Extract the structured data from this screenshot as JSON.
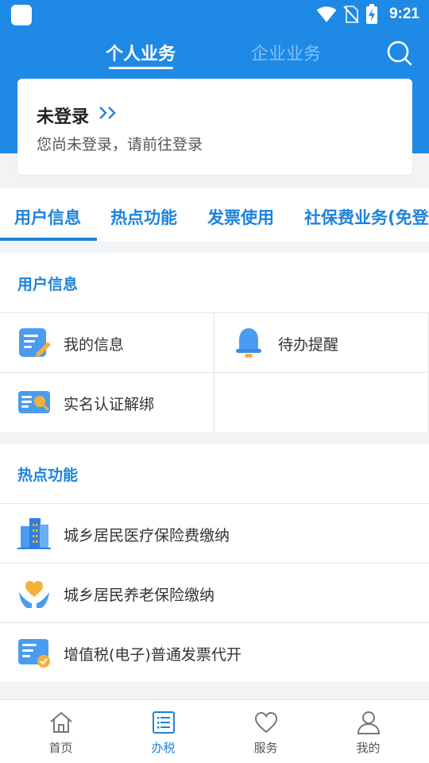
{
  "colors": {
    "primary": "#1e8ae6",
    "accent": "#1d83de",
    "background": "#f2f3f5"
  },
  "status_bar": {
    "time": "9:21",
    "icons": [
      "app-icon",
      "wifi-icon",
      "no-sim-icon",
      "battery-charging-icon"
    ]
  },
  "top_tabs": [
    {
      "label": "个人业务",
      "active": true
    },
    {
      "label": "企业业务",
      "active": false
    }
  ],
  "login": {
    "title": "未登录",
    "subtitle": "您尚未登录，请前往登录"
  },
  "categories": [
    "用户信息",
    "热点功能",
    "发票使用",
    "社保费业务(免登"
  ],
  "user_info": {
    "title": "用户信息",
    "items": [
      {
        "label": "我的信息",
        "icon": "edit-document-icon"
      },
      {
        "label": "待办提醒",
        "icon": "bell-icon"
      },
      {
        "label": "实名认证解绑",
        "icon": "id-card-search-icon"
      }
    ]
  },
  "hot": {
    "title": "热点功能",
    "items": [
      {
        "label": "城乡居民医疗保险费缴纳",
        "icon": "buildings-icon"
      },
      {
        "label": "城乡居民养老保险缴纳",
        "icon": "heart-hands-icon"
      },
      {
        "label": "增值税(电子)普通发票代开",
        "icon": "invoice-icon"
      }
    ]
  },
  "bottom_nav": [
    {
      "label": "首页",
      "icon": "home-icon",
      "active": false
    },
    {
      "label": "办税",
      "icon": "list-icon",
      "active": true
    },
    {
      "label": "服务",
      "icon": "heart-icon",
      "active": false
    },
    {
      "label": "我的",
      "icon": "person-icon",
      "active": false
    }
  ]
}
